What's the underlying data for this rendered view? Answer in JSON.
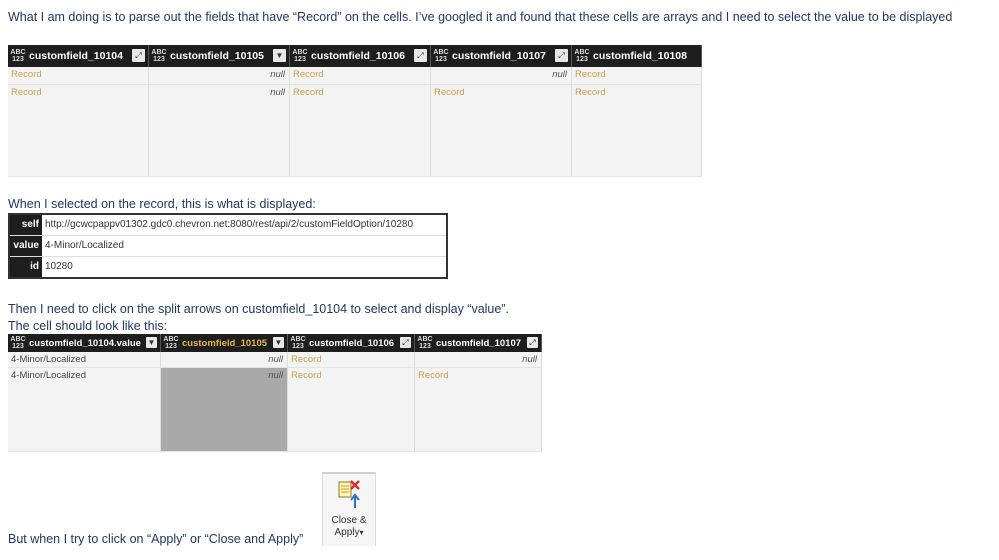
{
  "intro": "What I am doing is to  parse out the fields that have “Record” on the cells. I’ve googled it and found that these cells are arrays and I need to select the value to be displayed",
  "grid1": {
    "columns": [
      "customfield_10104",
      "customfield_10105",
      "customfield_10106",
      "customfield_10107",
      "customfield_10108"
    ],
    "type_label_top": "ABC",
    "type_label_bottom": "123",
    "rows": [
      [
        "Record",
        "null",
        "Record",
        "null",
        "Record"
      ],
      [
        "Record",
        "null",
        "Record",
        "Record",
        "Record"
      ]
    ]
  },
  "caption_selected": "When I selected on the record, this is what is displayed:",
  "record": [
    {
      "key": "self",
      "value": "http://gcwcpappv01302.gdc0.chevron.net:8080/rest/api/2/customFieldOption/10280"
    },
    {
      "key": "value",
      "value": "4-Minor/Localized"
    },
    {
      "key": "id",
      "value": "10280"
    }
  ],
  "caption_split": "Then I need to click on the split arrows on customfield_10104 to select and display “value”.",
  "caption_cell": "The cell should look like this:",
  "grid2": {
    "columns": [
      "customfield_10104.value",
      "customfield_10105",
      "customfield_10106",
      "customfield_10107"
    ],
    "rows": [
      [
        "4-Minor/Localized",
        "null",
        "Record",
        "null"
      ],
      [
        "4-Minor/Localized",
        "null",
        "Record",
        "Record"
      ]
    ]
  },
  "ribbon": {
    "label_line1": "Close &",
    "label_line2": "Apply",
    "arrow": "▾"
  },
  "caption_apply": "But when I try to click on “Apply” or “Close and Apply”"
}
